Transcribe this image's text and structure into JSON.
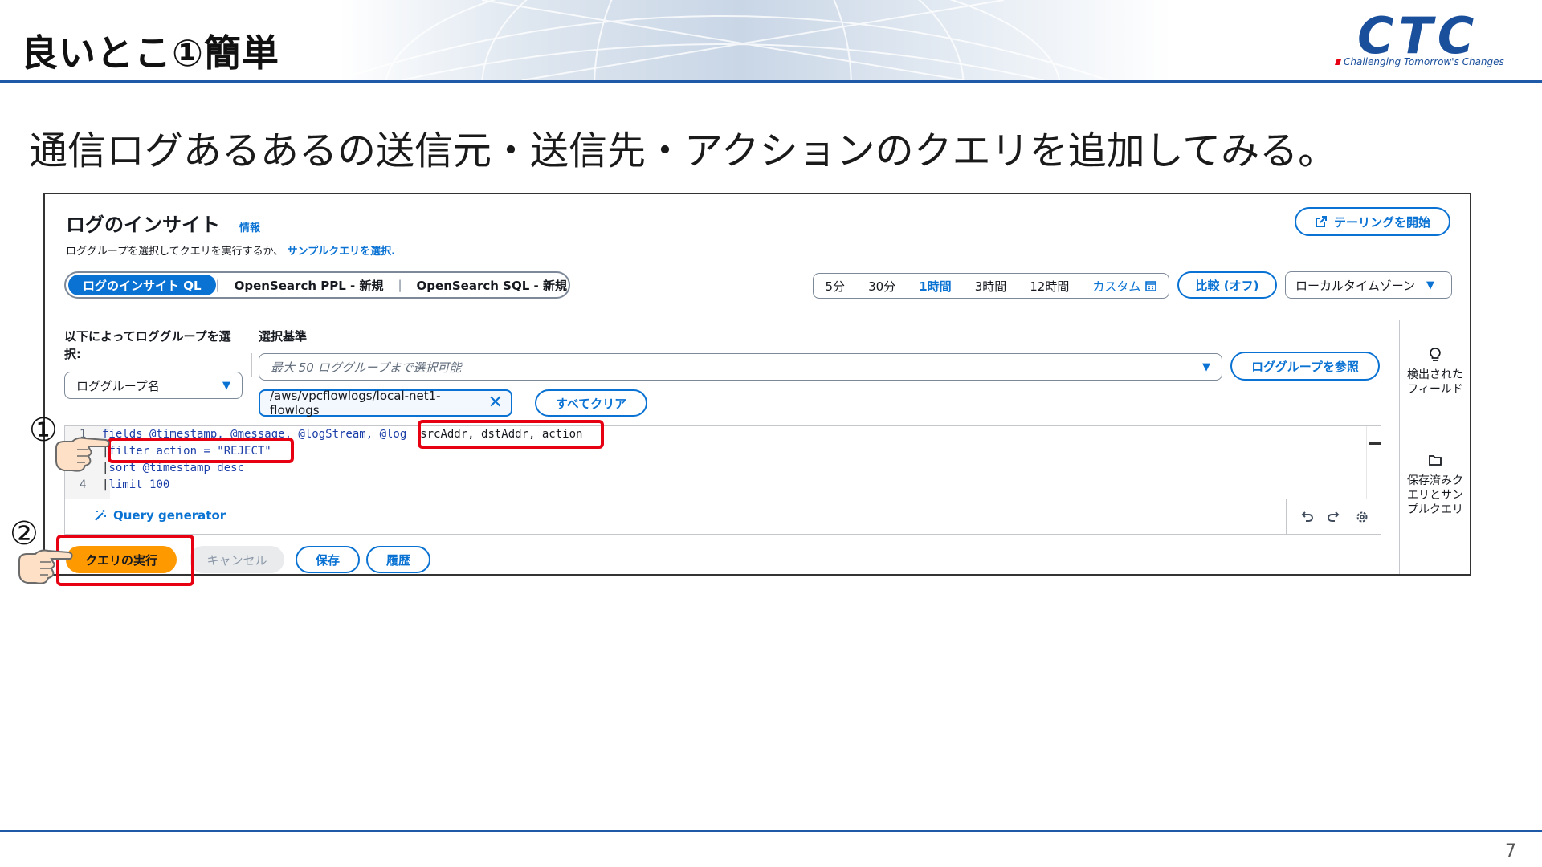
{
  "slide": {
    "title": "良いとこ①簡単",
    "subtitle": "通信ログあるあるの送信元・送信先・アクションのクエリを追加してみる。",
    "page_number": "7",
    "logo_text": "CTC",
    "logo_tagline": "Challenging Tomorrow's Changes",
    "accent_color": "#1f5aa8",
    "highlight_color": "#e60012"
  },
  "panel": {
    "title": "ログのインサイト",
    "info_link": "情報",
    "description": "ロググループを選択してクエリを実行するか、",
    "sample_link": "サンプルクエリを選択.",
    "tail_button": "テーリングを開始",
    "query_languages": [
      "ログのインサイト QL",
      "OpenSearch PPL - 新規",
      "OpenSearch SQL - 新規"
    ],
    "time_ranges": [
      "5分",
      "30分",
      "1時間",
      "3時間",
      "12時間"
    ],
    "time_range_selected": "1時間",
    "custom_label": "カスタム",
    "compare_button": "比較 (オフ)",
    "timezone": "ローカルタイムゾーン",
    "select_by_label": "以下によってロググループを選択:",
    "select_by_value": "ロググループ名",
    "criteria_label": "選択基準",
    "criteria_placeholder": "最大 50 ロググループまで選択可能",
    "browse_button": "ロググループを参照",
    "selected_group": "/aws/vpcflowlogs/local-net1-flowlogs",
    "clear_all_button": "すべてクリア",
    "query_generator": "Query generator",
    "run_button": "クエリの実行",
    "cancel_button": "キャンセル",
    "save_button": "保存",
    "history_button": "履歴",
    "rail": {
      "discovered_fields": "検出されたフィールド",
      "saved_queries": "保存済みクエリとサンプルクエリ"
    }
  },
  "query": {
    "line1_prefix": "fields @timestamp, @message, @logStream, @log",
    "line1_added": "srcAddr, dstAddr, action",
    "line2": "filter action = \"REJECT\"",
    "line3": "sort @timestamp desc",
    "line4": "limit 100",
    "line_number_4": "4"
  },
  "annotations": {
    "step1": "①",
    "step2": "②"
  }
}
